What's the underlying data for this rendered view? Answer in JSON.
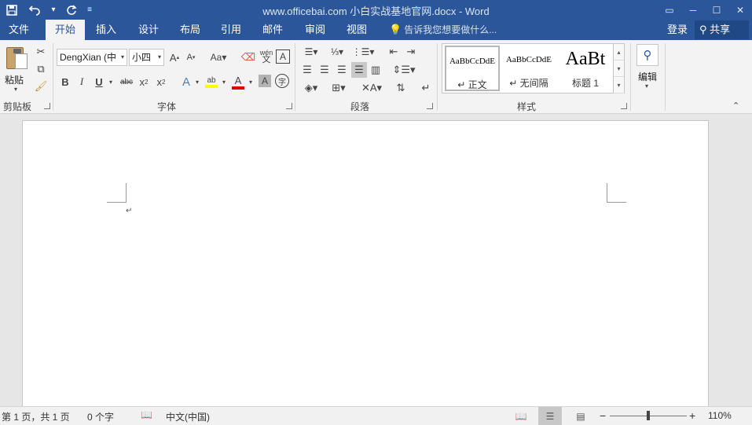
{
  "window": {
    "title": "www.officebai.com 小白实战基地官网.docx - Word"
  },
  "qat": {
    "save": "save-icon",
    "undo": "undo-icon",
    "redo": "redo-icon",
    "customize": "customize-qat-icon"
  },
  "tabs": [
    {
      "label": "文件",
      "active": false
    },
    {
      "label": "开始",
      "active": true
    },
    {
      "label": "插入",
      "active": false
    },
    {
      "label": "设计",
      "active": false
    },
    {
      "label": "布局",
      "active": false
    },
    {
      "label": "引用",
      "active": false
    },
    {
      "label": "邮件",
      "active": false
    },
    {
      "label": "审阅",
      "active": false
    },
    {
      "label": "视图",
      "active": false
    }
  ],
  "tellme": "告诉我您想要做什么...",
  "login": "登录",
  "share": "共享",
  "groups": {
    "clipboard": {
      "label": "剪贴板",
      "paste": "粘贴"
    },
    "font": {
      "label": "字体",
      "font_name": "DengXian (中",
      "font_size": "小四"
    },
    "paragraph": {
      "label": "段落"
    },
    "styles": {
      "label": "样式",
      "items": [
        {
          "sample": "AaBbCcDdE",
          "name": "↵ 正文"
        },
        {
          "sample": "AaBbCcDdE",
          "name": "↵ 无间隔"
        },
        {
          "sample": "AaBt",
          "name": "标题 1"
        }
      ]
    },
    "editing": {
      "label": "编辑"
    }
  },
  "status": {
    "page": "第 1 页，共 1 页",
    "words": "0 个字",
    "language": "中文(中国)",
    "zoom": "110%",
    "zoom_level_percent": 110
  },
  "colors": {
    "brand": "#2b579a",
    "highlight": "#ffff00",
    "font_color": "#e00000"
  }
}
